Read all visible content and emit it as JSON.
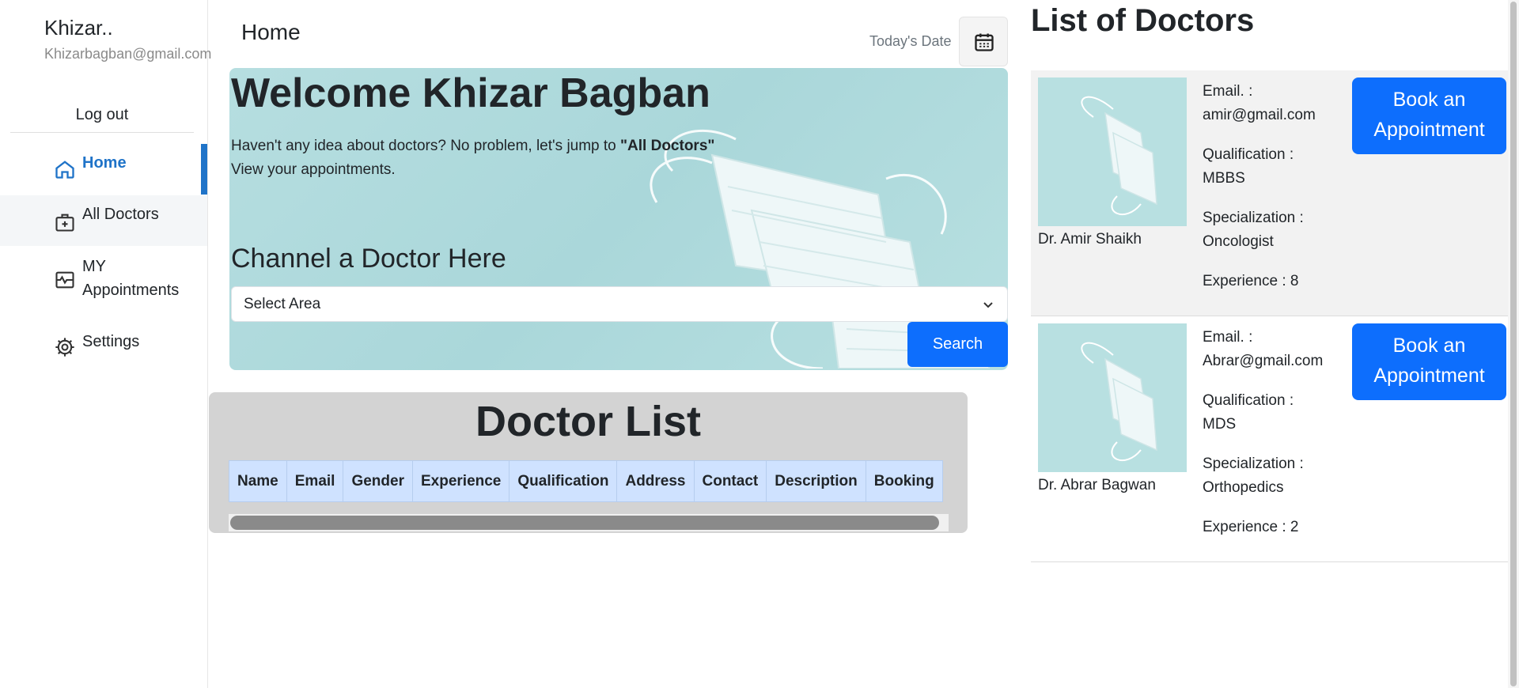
{
  "profile": {
    "name": "Khizar..",
    "email": "Khizarbagban@gmail.com"
  },
  "sidebar": {
    "logout_label": "Log out",
    "items": [
      {
        "label": "Home",
        "icon": "home-icon",
        "active": true
      },
      {
        "label": "All Doctors",
        "icon": "medical-bag-icon",
        "active": false
      },
      {
        "label": "MY\nAppointments",
        "label_line1": "MY",
        "label_line2": "Appointments",
        "icon": "schedule-icon",
        "active": false
      },
      {
        "label": "Settings",
        "icon": "gear-icon",
        "active": false
      }
    ]
  },
  "header": {
    "title": "Home",
    "date_label": "Today's Date"
  },
  "banner": {
    "welcome": "Welcome Khizar Bagban",
    "intro_prefix": "Haven't any idea about doctors? No problem, let's jump to ",
    "intro_link": "\"All Doctors\"",
    "intro_line2": "View your appointments.",
    "channel_title": "Channel a Doctor Here",
    "select_value": "Select Area",
    "search_label": "Search"
  },
  "doctor_list": {
    "title": "Doctor List",
    "columns": [
      "Name",
      "Email",
      "Gender",
      "Experience",
      "Qualification",
      "Address",
      "Contact",
      "Description",
      "Booking"
    ]
  },
  "right_panel": {
    "title": "List of Doctors",
    "book_label_line1": "Book an",
    "book_label_line2": "Appointment",
    "doctors": [
      {
        "name": "Dr. Amir Shaikh",
        "email_label": "Email. :",
        "email": "amir@gmail.com",
        "qualification_label": "Qualification :",
        "qualification": "MBBS",
        "specialization_label": "Specialization :",
        "specialization": "Oncologist",
        "experience": "Experience : 8"
      },
      {
        "name": "Dr. Abrar Bagwan",
        "email_label": "Email. :",
        "email": "Abrar@gmail.com",
        "qualification_label": "Qualification :",
        "qualification": "MDS",
        "specialization_label": "Specialization :",
        "specialization": "Orthopedics",
        "experience": "Experience : 2"
      }
    ]
  },
  "colors": {
    "primary": "#0d6efd",
    "active_nav": "#1f73c8",
    "banner_bg": "#aad7da",
    "table_header": "#cfe2ff"
  }
}
